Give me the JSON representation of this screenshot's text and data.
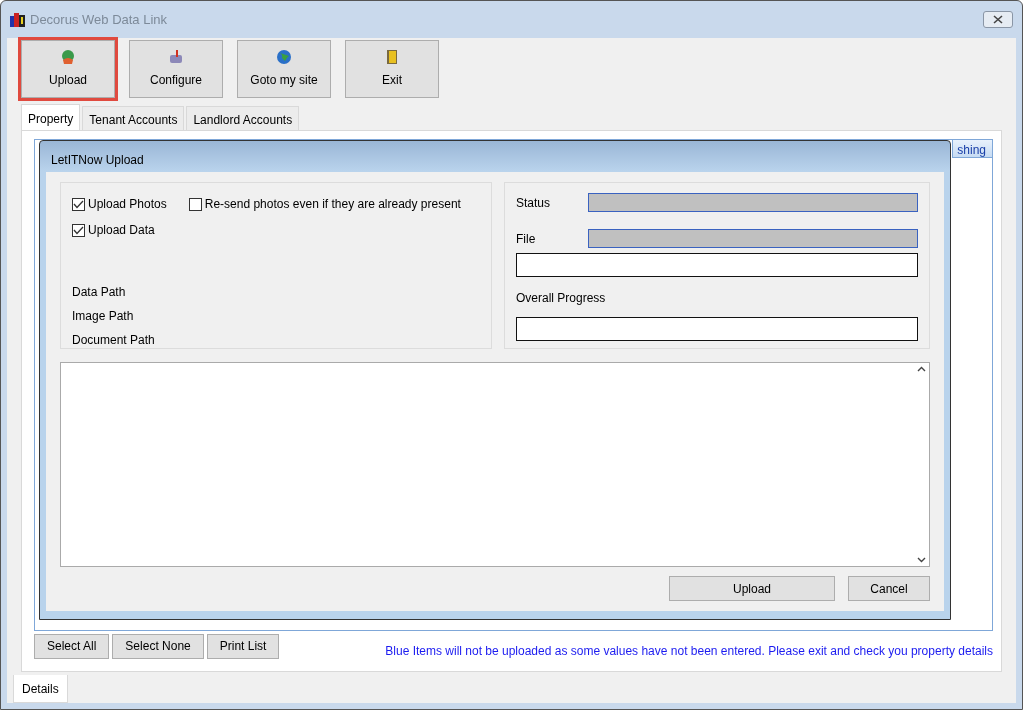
{
  "window": {
    "title": "Decorus Web Data Link"
  },
  "toolbar": [
    {
      "label": "Upload",
      "selected": true
    },
    {
      "label": "Configure",
      "selected": false
    },
    {
      "label": "Goto my site",
      "selected": false
    },
    {
      "label": "Exit",
      "selected": false
    }
  ],
  "tabs": [
    {
      "label": "Property",
      "selected": true
    },
    {
      "label": "Tenant Accounts",
      "selected": false
    },
    {
      "label": "Landlord Accounts",
      "selected": false
    }
  ],
  "list_header": {
    "column_partial": "shing"
  },
  "dialog": {
    "title": "LetITNow Upload",
    "options": [
      {
        "label": "Upload Photos",
        "checked": true
      },
      {
        "label": "Re-send photos even if they are already present",
        "checked": false
      },
      {
        "label": "Upload Data",
        "checked": true
      }
    ],
    "paths": [
      "Data Path",
      "Image Path",
      "Document Path"
    ],
    "status_label": "Status",
    "file_label": "File",
    "file_progress": {
      "level": 0
    },
    "overall_label": "Overall Progress",
    "overall_progress": {
      "level": 0
    },
    "buttons": [
      "Upload",
      "Cancel"
    ]
  },
  "bottom_buttons": [
    "Select All",
    "Select None",
    "Print List"
  ],
  "notice": "Blue Items will not be uploaded as some values have not been entered. Please exit and check you property details",
  "bottom_tabs": [
    {
      "label": "Details",
      "selected": true
    }
  ]
}
